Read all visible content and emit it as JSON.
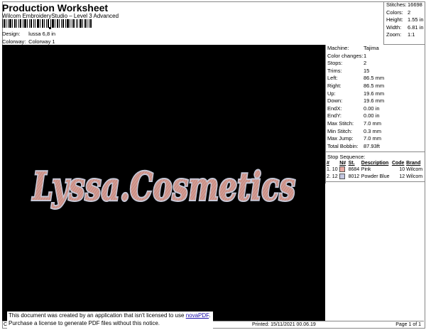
{
  "header": {
    "title": "Production Worksheet",
    "subtitle": "Wilcom EmbroideryStudio – Level 3 Advanced",
    "design_label": "Design:",
    "design_value": "lussa 6,8 in",
    "colorway_label": "Colorway:",
    "colorway_value": "Colorway 1"
  },
  "summary": [
    {
      "label": "Stitches:",
      "value": "16698"
    },
    {
      "label": "Colors:",
      "value": "2"
    },
    {
      "label": "Height:",
      "value": "1.55 in"
    },
    {
      "label": "Width:",
      "value": "6.81 in"
    },
    {
      "label": "Zoom:",
      "value": "1:1"
    }
  ],
  "design": {
    "text": "Lyssa.Cosmetics",
    "fill_color": "#c98f86",
    "outline_color": "#c6c7d6",
    "background_color": "#000000"
  },
  "machine_info": [
    {
      "label": "Machine:",
      "value": "Tajima"
    },
    {
      "label": "Color changes:",
      "value": "1"
    },
    {
      "label": "Stops:",
      "value": "2"
    },
    {
      "label": "Trims:",
      "value": "15"
    },
    {
      "label": "Left:",
      "value": "86.5 mm"
    },
    {
      "label": "Right:",
      "value": "86.5 mm"
    },
    {
      "label": "Up:",
      "value": "19.6 mm"
    },
    {
      "label": "Down:",
      "value": "19.6 mm"
    },
    {
      "label": "EndX:",
      "value": "0.00 in"
    },
    {
      "label": "EndY:",
      "value": "0.00 in"
    },
    {
      "label": "Max Stitch:",
      "value": "7.0 mm"
    },
    {
      "label": "Min Stitch:",
      "value": "0.3 mm"
    },
    {
      "label": "Max Jump:",
      "value": "7.0 mm"
    },
    {
      "label": "Total Bobbin:",
      "value": "87.93ft"
    }
  ],
  "stop_sequence": {
    "title": "Stop Sequence:",
    "headers": [
      "#",
      "N#",
      "St.",
      "Description",
      "Code",
      "Brand"
    ],
    "rows": [
      {
        "num": "1.",
        "n": "10",
        "swatch": "#e8a7a0",
        "st": "8684",
        "desc": "Pink",
        "code": "10",
        "brand": "Wilcom"
      },
      {
        "num": "2.",
        "n": "12",
        "swatch": "#c3c6e0",
        "st": "8012",
        "desc": "Powder Blue",
        "code": "12",
        "brand": "Wilcom"
      }
    ]
  },
  "footer": {
    "left": "Cr",
    "printed": "Printed: 15/11/2021 00.06.19",
    "page": "Page 1 of 1"
  },
  "notice": {
    "line1_prefix": "This document was created by an application that isn't licensed to use",
    "link": "novaPDF",
    "line2": "Purchase a license to generate PDF files without this notice."
  }
}
